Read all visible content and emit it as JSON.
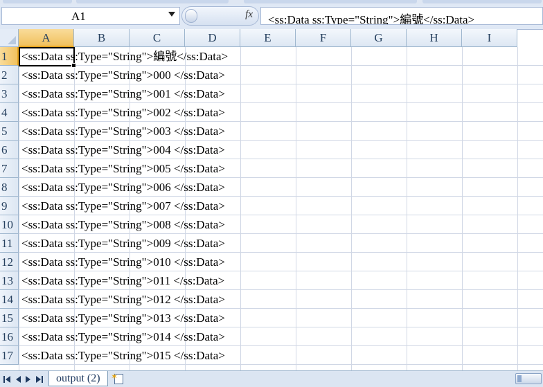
{
  "formula_bar": {
    "name_box": "A1",
    "fx_label": "fx",
    "formula": "<ss:Data ss:Type=\"String\">編號</ss:Data>"
  },
  "columns": [
    "A",
    "B",
    "C",
    "D",
    "E",
    "F",
    "G",
    "H",
    "I"
  ],
  "rows": [
    {
      "num": "1",
      "text": "<ss:Data ss:Type=\"String\">編號</ss:Data>"
    },
    {
      "num": "2",
      "text": "<ss:Data ss:Type=\"String\">000 </ss:Data>"
    },
    {
      "num": "3",
      "text": "<ss:Data ss:Type=\"String\">001 </ss:Data>"
    },
    {
      "num": "4",
      "text": "<ss:Data ss:Type=\"String\">002 </ss:Data>"
    },
    {
      "num": "5",
      "text": "<ss:Data ss:Type=\"String\">003 </ss:Data>"
    },
    {
      "num": "6",
      "text": "<ss:Data ss:Type=\"String\">004 </ss:Data>"
    },
    {
      "num": "7",
      "text": "<ss:Data ss:Type=\"String\">005 </ss:Data>"
    },
    {
      "num": "8",
      "text": "<ss:Data ss:Type=\"String\">006 </ss:Data>"
    },
    {
      "num": "9",
      "text": "<ss:Data ss:Type=\"String\">007 </ss:Data>"
    },
    {
      "num": "10",
      "text": "<ss:Data ss:Type=\"String\">008 </ss:Data>"
    },
    {
      "num": "11",
      "text": "<ss:Data ss:Type=\"String\">009 </ss:Data>"
    },
    {
      "num": "12",
      "text": "<ss:Data ss:Type=\"String\">010 </ss:Data>"
    },
    {
      "num": "13",
      "text": "<ss:Data ss:Type=\"String\">011 </ss:Data>"
    },
    {
      "num": "14",
      "text": "<ss:Data ss:Type=\"String\">012 </ss:Data>"
    },
    {
      "num": "15",
      "text": "<ss:Data ss:Type=\"String\">013 </ss:Data>"
    },
    {
      "num": "16",
      "text": "<ss:Data ss:Type=\"String\">014 </ss:Data>"
    },
    {
      "num": "17",
      "text": "<ss:Data ss:Type=\"String\">015 </ss:Data>"
    }
  ],
  "sheet_tabs": {
    "active": "output (2)"
  },
  "icons": {
    "name_box_dropdown": "chevron-down-icon",
    "insert_function": "fx-icon",
    "insert_sheet": "insert-sheet-icon"
  },
  "colors": {
    "selected_header": "#f1c15e",
    "header_bg": "#dde7f3",
    "gridline": "#d0d7e5"
  }
}
